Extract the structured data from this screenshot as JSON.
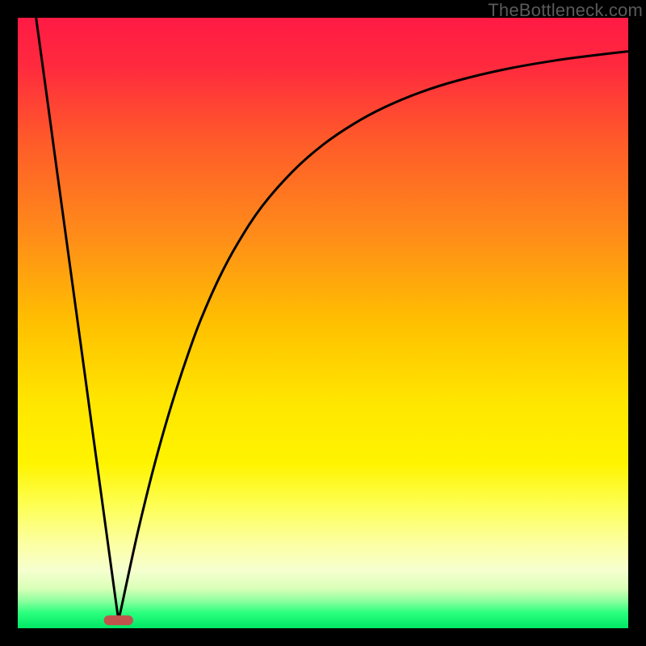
{
  "watermark": "TheBottleneck.com",
  "chart_data": {
    "type": "line",
    "title": "",
    "xlabel": "",
    "ylabel": "",
    "xlim": [
      0,
      100
    ],
    "ylim": [
      0,
      100
    ],
    "grid": false,
    "background_gradient": {
      "stops": [
        {
          "offset": 0.0,
          "color": "#ff1a44"
        },
        {
          "offset": 0.08,
          "color": "#ff2a3e"
        },
        {
          "offset": 0.2,
          "color": "#ff5a2a"
        },
        {
          "offset": 0.35,
          "color": "#ff8a1a"
        },
        {
          "offset": 0.5,
          "color": "#ffc000"
        },
        {
          "offset": 0.63,
          "color": "#ffe600"
        },
        {
          "offset": 0.73,
          "color": "#fff400"
        },
        {
          "offset": 0.8,
          "color": "#fdff55"
        },
        {
          "offset": 0.86,
          "color": "#fcffa0"
        },
        {
          "offset": 0.905,
          "color": "#f6ffcf"
        },
        {
          "offset": 0.935,
          "color": "#d9ffb8"
        },
        {
          "offset": 0.955,
          "color": "#8fff9e"
        },
        {
          "offset": 0.975,
          "color": "#29ff7d"
        },
        {
          "offset": 1.0,
          "color": "#00e765"
        }
      ]
    },
    "vertex": {
      "x": 16.5,
      "y": 1.3
    },
    "marker": {
      "shape": "pill",
      "color": "#c1534d",
      "x": 16.5,
      "y": 1.3,
      "w": 4.8,
      "h": 1.6
    },
    "series": [
      {
        "name": "left-branch",
        "x": [
          3.0,
          4.0,
          5.0,
          6.0,
          7.0,
          8.0,
          9.0,
          10.0,
          11.0,
          12.0,
          13.0,
          14.0,
          15.0,
          16.0,
          16.5
        ],
        "y": [
          100.0,
          92.7,
          85.4,
          78.0,
          70.7,
          63.4,
          56.1,
          48.8,
          41.5,
          34.1,
          26.8,
          19.5,
          12.2,
          4.9,
          1.3
        ]
      },
      {
        "name": "right-branch",
        "x": [
          16.5,
          17,
          18,
          19,
          20,
          22,
          24,
          26,
          28,
          30,
          33,
          36,
          40,
          45,
          50,
          55,
          60,
          66,
          72,
          80,
          88,
          94,
          100
        ],
        "y": [
          1.3,
          3.5,
          8.2,
          12.8,
          17.2,
          25.3,
          32.6,
          39.2,
          45.2,
          50.6,
          57.4,
          63.0,
          69.1,
          74.8,
          79.2,
          82.6,
          85.3,
          87.8,
          89.7,
          91.6,
          93.0,
          93.8,
          94.5
        ]
      }
    ]
  }
}
